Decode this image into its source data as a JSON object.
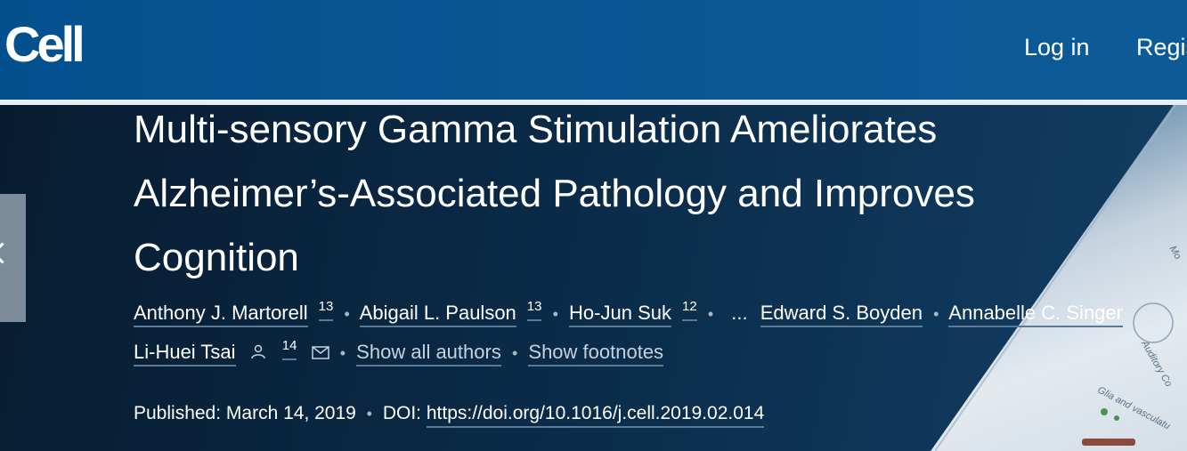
{
  "header": {
    "logo": "Cell",
    "login_label": "Log in",
    "register_label": "Register"
  },
  "article": {
    "title": "Multi-sensory Gamma Stimulation Ameliorates Alzheimer’s-Associated Pathology and Improves Cognition",
    "authors_line1": [
      {
        "name": "Anthony J. Martorell",
        "sup": "13"
      },
      {
        "name": "Abigail L. Paulson",
        "sup": "13"
      },
      {
        "name": "Ho-Jun Suk",
        "sup": "12"
      }
    ],
    "ellipsis": "...",
    "authors_line1_tail": [
      {
        "name": "Edward S. Boyden"
      },
      {
        "name": "Annabelle C. Singer"
      }
    ],
    "corresponding_author": {
      "name": "Li-Huei Tsai",
      "sup": "14",
      "person_icon": "person-icon",
      "mail_icon": "mail-icon"
    },
    "show_all_authors": "Show all authors",
    "show_footnotes": "Show footnotes",
    "published_label": "Published: March 14, 2019",
    "doi_label": "DOI:",
    "doi_link": "https://doi.org/10.1016/j.cell.2019.02.014"
  },
  "decoration": {
    "sheet_texts": [
      "Mo",
      "Auditory Co",
      "Glia and vasculatu"
    ]
  },
  "colors": {
    "header_bg": "#03508f",
    "hero_bg": "#0a2a47",
    "link_underline": "#5c7a94"
  }
}
